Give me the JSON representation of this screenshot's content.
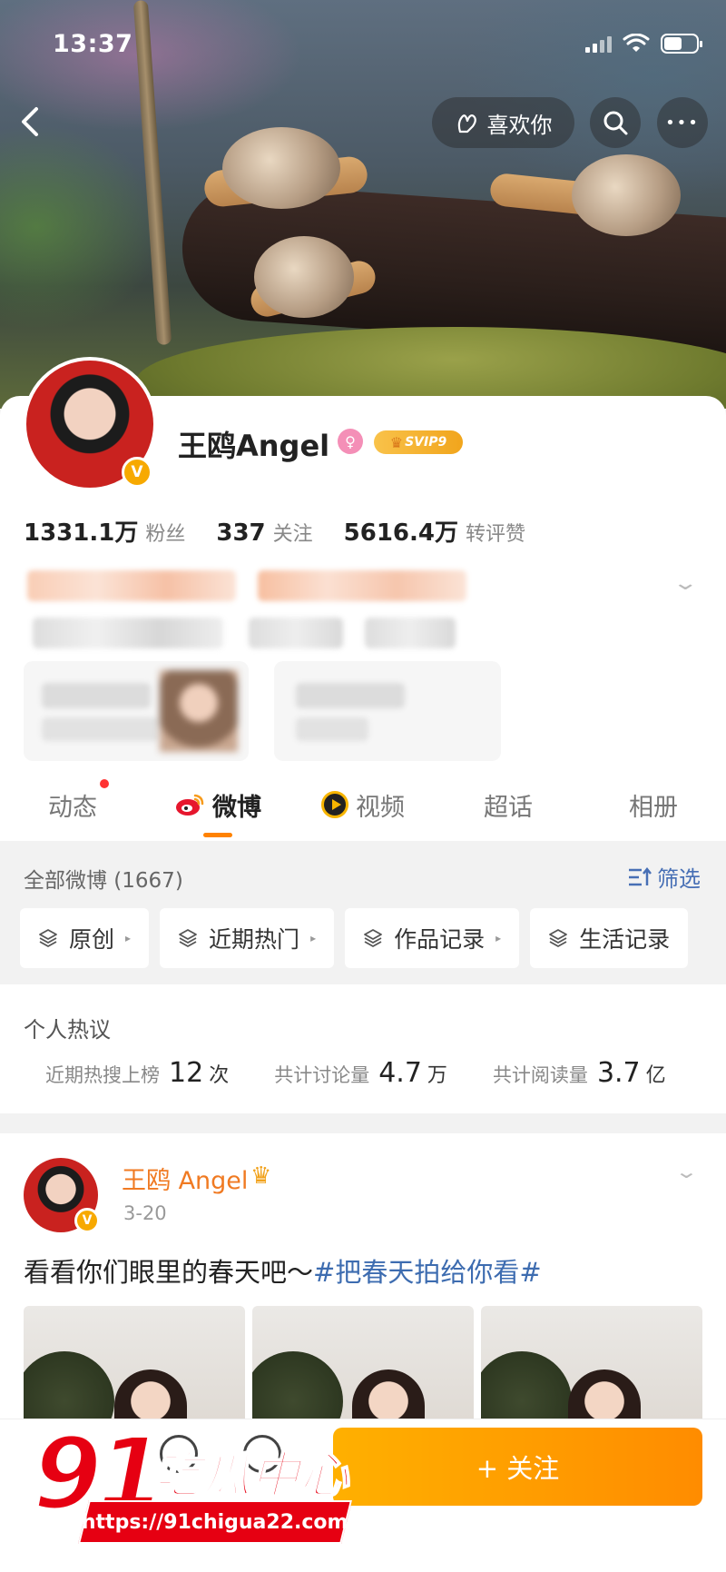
{
  "status_bar": {
    "time": "13:37"
  },
  "top_bar": {
    "like_label": "喜欢你",
    "more_label": "•••"
  },
  "profile": {
    "name": "王鸥Angel",
    "gender_symbol": "♀",
    "svip_label": "SVIP9",
    "verified_mark": "V",
    "stats": [
      {
        "value": "1331.1万",
        "label": "粉丝"
      },
      {
        "value": "337",
        "label": "关注"
      },
      {
        "value": "5616.4万",
        "label": "转评赞"
      }
    ]
  },
  "tabs": [
    {
      "label": "动态",
      "active": false
    },
    {
      "label": "微博",
      "active": true
    },
    {
      "label": "视频",
      "active": false
    },
    {
      "label": "超话",
      "active": false
    },
    {
      "label": "相册",
      "active": false
    }
  ],
  "feed_header": {
    "all_label": "全部微博 (1667)",
    "filter_label": "筛选"
  },
  "chips": [
    "原创",
    "近期热门",
    "作品记录",
    "生活记录"
  ],
  "hot": {
    "title": "个人热议",
    "items": [
      {
        "label": "近期热搜上榜",
        "value": "12",
        "unit": "次"
      },
      {
        "label": "共计讨论量",
        "value": "4.7",
        "unit": "万"
      },
      {
        "label": "共计阅读量",
        "value": "3.7",
        "unit": "亿"
      }
    ]
  },
  "post": {
    "author": "王鸥 Angel",
    "date": "3-20",
    "text": "看看你们眼里的春天吧～",
    "hashtag": "#把春天拍给你看#"
  },
  "bottom": {
    "follow_label": "+ 关注"
  },
  "watermark": {
    "number": "91",
    "brand": "吃瓜中心",
    "url": "https://91chigua22.com"
  },
  "colors": {
    "accent": "#ff8200",
    "link": "#476fb5",
    "watermark": "#e60012"
  }
}
